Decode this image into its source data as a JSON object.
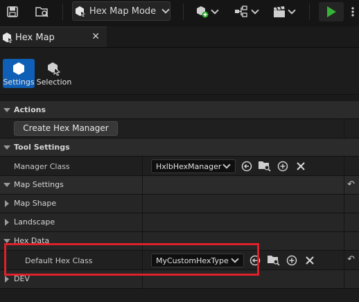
{
  "toolbar": {
    "mode_label": "Hex Map Mode",
    "icons": [
      "save-icon",
      "browse-icon",
      "hex-mode-icon",
      "add-actor-icon",
      "blueprint-icon",
      "cinematics-icon",
      "play-icon"
    ]
  },
  "tab": {
    "title": "Hex Map",
    "close": "✕"
  },
  "modes": [
    {
      "label": "Settings",
      "active": true
    },
    {
      "label": "Selection",
      "active": false
    }
  ],
  "sections": {
    "actions": "Actions",
    "create_button": "Create Hex Manager",
    "tool_settings": "Tool Settings",
    "manager_class_label": "Manager Class",
    "manager_class_value": "HxlbHexManager",
    "map_settings": "Map Settings",
    "map_shape": "Map Shape",
    "landscape": "Landscape",
    "hex_data": "Hex Data",
    "default_hex_class_label": "Default Hex Class",
    "default_hex_class_value": "MyCustomHexType",
    "dev": "DEV"
  },
  "colors": {
    "accent": "#0e5fb5",
    "highlight": "#e0202a",
    "play": "#35b335"
  }
}
